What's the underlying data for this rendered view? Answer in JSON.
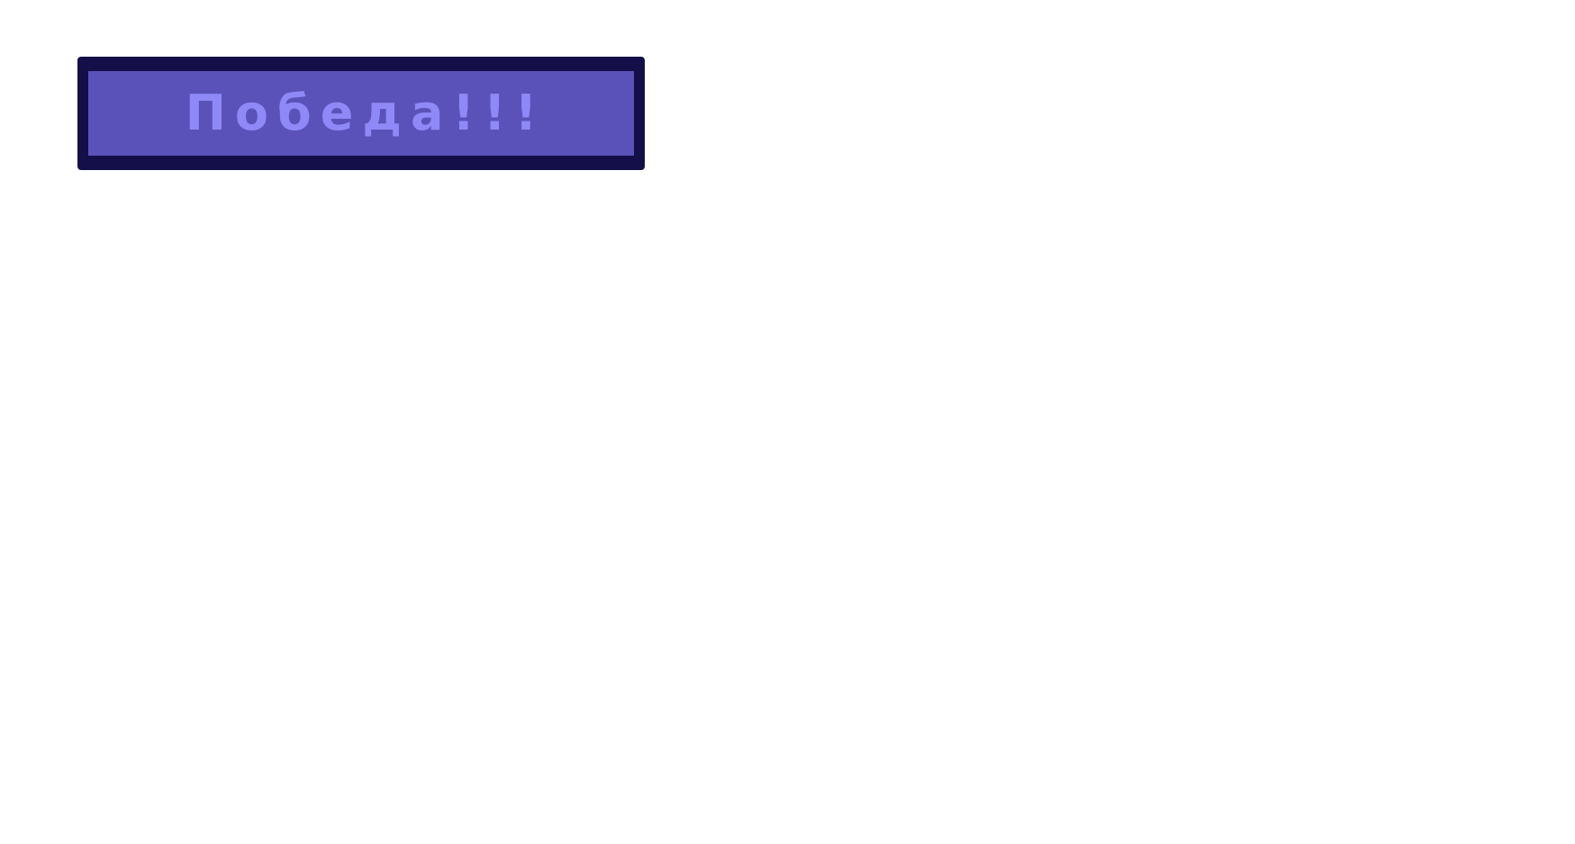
{
  "banner": {
    "text": "Победа!!!",
    "colors": {
      "frame": "#140f48",
      "fill": "#5a52b8",
      "text": "#8f89f7",
      "background": "#ffffff"
    }
  }
}
